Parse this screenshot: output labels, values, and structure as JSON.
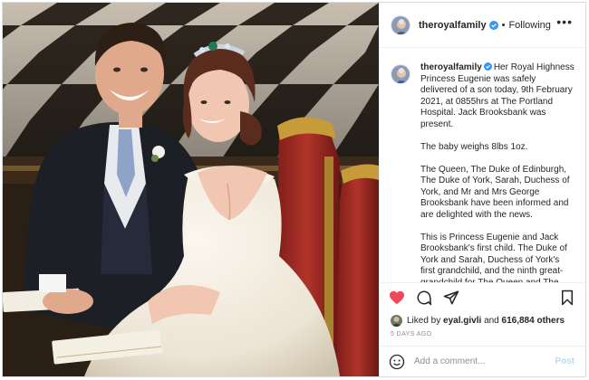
{
  "header": {
    "username": "theroyalfamily",
    "separator": "•",
    "follow_state": "Following",
    "more_label": "•••"
  },
  "caption": {
    "username": "theroyalfamily",
    "paragraphs": [
      "Her Royal Highness Princess Eugenie was safely delivered of a son today, 9th February 2021, at 0855hrs at The Portland Hospital. Jack Brooksbank was present.",
      "The baby weighs 8lbs 1oz.",
      "The Queen, The Duke of Edinburgh, The Duke of York, Sarah, Duchess of York, and Mr and Mrs George Brooksbank have been informed and are delighted with the news.",
      "This is Princess Eugenie and Jack Brooksbank's first child. The Duke of York and Sarah, Duchess of York's first grandchild, and the ninth great-grandchild for The Queen and The"
    ]
  },
  "likes": {
    "prefix": "Liked by",
    "user": "eyal.givli",
    "conjunction": "and",
    "count": "616,884 others"
  },
  "time_ago": "5 DAYS AGO",
  "comment": {
    "placeholder": "Add a comment...",
    "post_label": "Post"
  },
  "icons": {
    "like": "heart-icon-filled",
    "comment": "comment-icon",
    "share": "share-icon",
    "save": "bookmark-icon",
    "emoji": "smiley-icon",
    "verified": "verified-badge-icon"
  },
  "colors": {
    "like_red": "#ed4956",
    "verified_blue": "#3897f0",
    "post_button_disabled": "#b2dffc",
    "muted_text": "#8e8e8e"
  }
}
